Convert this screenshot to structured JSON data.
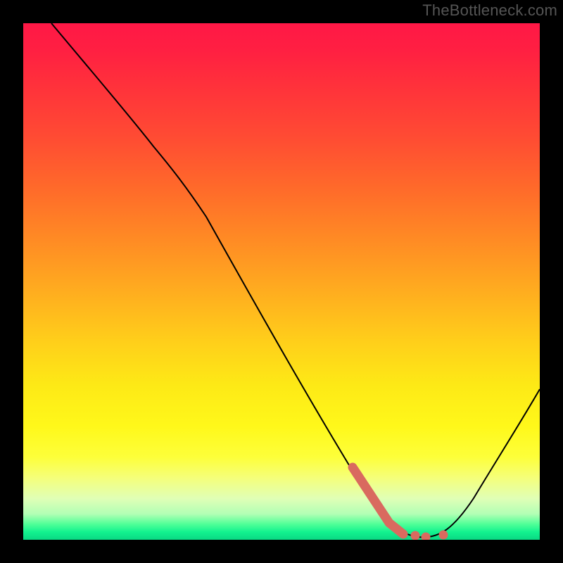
{
  "watermark": "TheBottleneck.com",
  "chart_data": {
    "type": "line",
    "title": "",
    "xlabel": "",
    "ylabel": "",
    "xlim": [
      0,
      100
    ],
    "ylim": [
      0,
      100
    ],
    "grid": false,
    "legend": false,
    "background": "vertical-heat-gradient red→yellow→green",
    "series": [
      {
        "name": "bottleneck-curve",
        "color": "#000000",
        "x": [
          5,
          12,
          20,
          25,
          30,
          35,
          40,
          45,
          50,
          55,
          60,
          65,
          68,
          72,
          76,
          80,
          84,
          88,
          92,
          96,
          100
        ],
        "values": [
          100,
          92,
          83,
          76,
          70,
          62,
          53,
          45,
          37,
          29,
          21,
          14,
          9,
          5,
          2,
          1,
          0,
          3,
          8,
          16,
          29
        ]
      },
      {
        "name": "highlight-range",
        "color": "#d96a5f",
        "style": "thick-with-dots",
        "x": [
          64,
          67,
          70,
          73,
          76,
          78,
          81
        ],
        "values": [
          14,
          10,
          6,
          3,
          1,
          0.5,
          0.7
        ]
      }
    ],
    "annotations": [
      {
        "text": "TheBottleneck.com",
        "position": "top-right",
        "role": "watermark"
      }
    ]
  }
}
